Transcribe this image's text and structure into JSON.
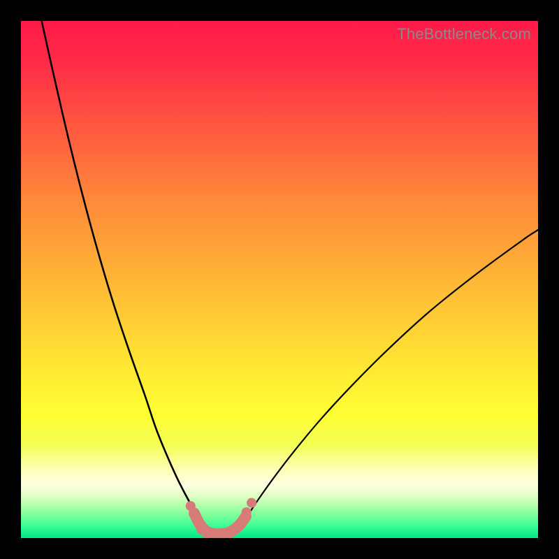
{
  "watermark": "TheBottleneck.com",
  "colors": {
    "frame": "#000000",
    "curve": "#000000",
    "marker_fill": "#d67b78",
    "gradient_stops": [
      {
        "offset": 0.0,
        "color": "#ff1a49"
      },
      {
        "offset": 0.08,
        "color": "#ff2b47"
      },
      {
        "offset": 0.2,
        "color": "#ff5640"
      },
      {
        "offset": 0.35,
        "color": "#ff8a3a"
      },
      {
        "offset": 0.5,
        "color": "#ffb636"
      },
      {
        "offset": 0.65,
        "color": "#ffe233"
      },
      {
        "offset": 0.76,
        "color": "#ffff33"
      },
      {
        "offset": 0.82,
        "color": "#f4ff55"
      },
      {
        "offset": 0.865,
        "color": "#fdffb0"
      },
      {
        "offset": 0.895,
        "color": "#ffffe0"
      },
      {
        "offset": 0.915,
        "color": "#e7ffca"
      },
      {
        "offset": 0.935,
        "color": "#b6ffad"
      },
      {
        "offset": 0.955,
        "color": "#7fff9a"
      },
      {
        "offset": 0.975,
        "color": "#40ff95"
      },
      {
        "offset": 1.0,
        "color": "#00e886"
      }
    ]
  },
  "chart_data": {
    "type": "line",
    "title": "",
    "xlabel": "",
    "ylabel": "",
    "xlim": [
      0,
      100
    ],
    "ylim": [
      0,
      100
    ],
    "grid": false,
    "series": [
      {
        "name": "bottleneck-curve-left",
        "x": [
          4,
          6,
          9,
          12,
          15,
          18,
          21,
          24,
          26,
          28,
          30,
          31.5,
          33,
          34.2,
          35,
          35.6
        ],
        "y": [
          100,
          91,
          78,
          66,
          55,
          45,
          36,
          27.5,
          21.5,
          16.5,
          12,
          9,
          6.2,
          3.8,
          2,
          0.8
        ]
      },
      {
        "name": "bottleneck-curve-right",
        "x": [
          41.5,
          42.5,
          44,
          46,
          49,
          53,
          58,
          64,
          71,
          79,
          88,
          97,
          100
        ],
        "y": [
          1.0,
          2.4,
          4.6,
          7.6,
          11.8,
          17.0,
          23.0,
          29.5,
          36.5,
          43.8,
          51.0,
          57.6,
          59.6
        ]
      },
      {
        "name": "trough-midline",
        "x": [
          33.5,
          34.5,
          35.5,
          36.5,
          37.5,
          38.5,
          39.5,
          40.5,
          41.5,
          42.5,
          43.5
        ],
        "y": [
          4.8,
          2.8,
          1.6,
          1.0,
          0.8,
          0.8,
          0.9,
          1.2,
          1.8,
          2.8,
          4.2
        ]
      }
    ],
    "markers": [
      {
        "x": 32.8,
        "y": 6.2,
        "r": 0.95
      },
      {
        "x": 34.0,
        "y": 3.6,
        "r": 0.95
      },
      {
        "x": 35.0,
        "y": 1.8,
        "r": 1.15
      },
      {
        "x": 36.2,
        "y": 0.9,
        "r": 1.15
      },
      {
        "x": 37.5,
        "y": 0.6,
        "r": 1.15
      },
      {
        "x": 38.8,
        "y": 0.6,
        "r": 1.15
      },
      {
        "x": 40.0,
        "y": 0.9,
        "r": 1.15
      },
      {
        "x": 41.2,
        "y": 1.6,
        "r": 1.1
      },
      {
        "x": 42.8,
        "y": 3.4,
        "r": 0.95
      },
      {
        "x": 43.6,
        "y": 5.0,
        "r": 0.95
      },
      {
        "x": 44.6,
        "y": 6.8,
        "r": 0.95
      }
    ]
  }
}
